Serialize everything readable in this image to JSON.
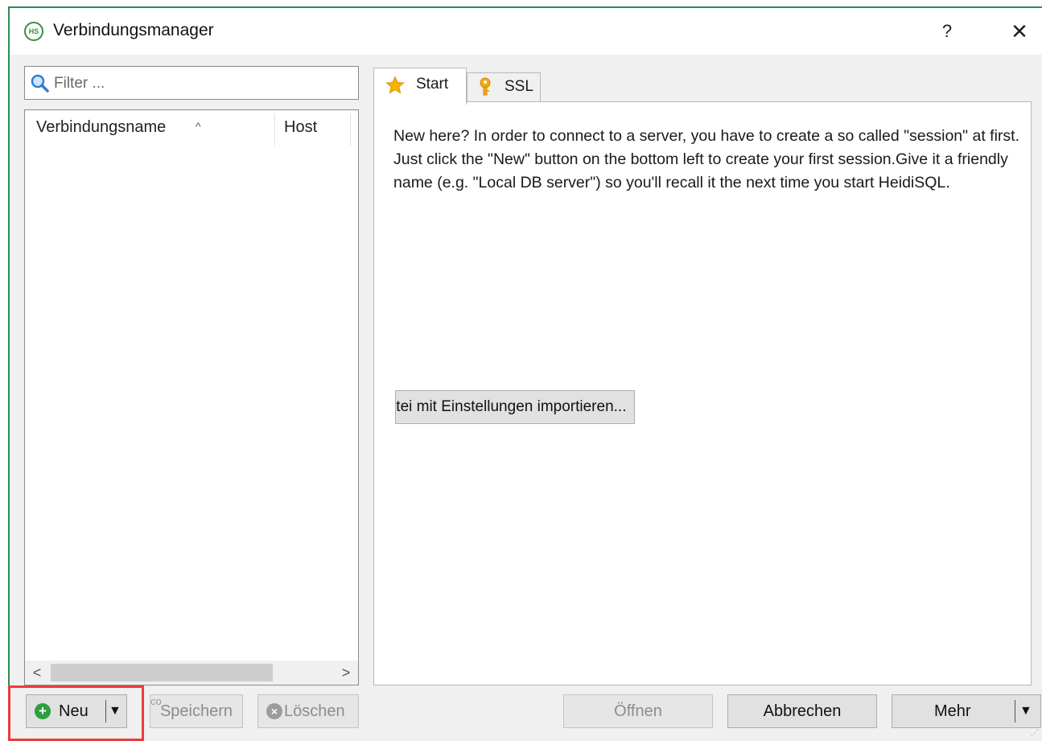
{
  "window": {
    "title": "Verbindungsmanager",
    "app_icon_text": "HS",
    "help_label": "?",
    "close_label": "✕"
  },
  "sessions": {
    "filter_placeholder": "Filter ...",
    "filter_value": "",
    "columns": [
      {
        "label": "Verbindungsname",
        "sort": "^"
      },
      {
        "label": "Host"
      }
    ],
    "rows": [],
    "scroll_left": "<",
    "scroll_right": ">"
  },
  "tabs": [
    {
      "label": "Start",
      "icon": "star-icon",
      "active": true
    },
    {
      "label": "SSL",
      "icon": "key-icon",
      "active": false
    }
  ],
  "start": {
    "intro": "New here? In order to connect to a server, you have to create a so called \"session\" at first. Just click the \"New\" button on the bottom left to create your first session.Give it a friendly name (e.g. \"Local DB server\") so you'll recall it the next time you start HeidiSQL.",
    "import_button": "Datei mit Einstellungen importieren..."
  },
  "buttons": {
    "new": "Neu",
    "new_arrow": "▼",
    "save": "Speichern",
    "save_overlay": "co",
    "delete": "Löschen",
    "open": "Öffnen",
    "cancel": "Abbrechen",
    "more": "Mehr",
    "more_arrow": "▼"
  },
  "colors": {
    "accent_green": "#2e9e3e",
    "highlight_red": "#ee3b3b",
    "window_border": "#2e8b57"
  }
}
